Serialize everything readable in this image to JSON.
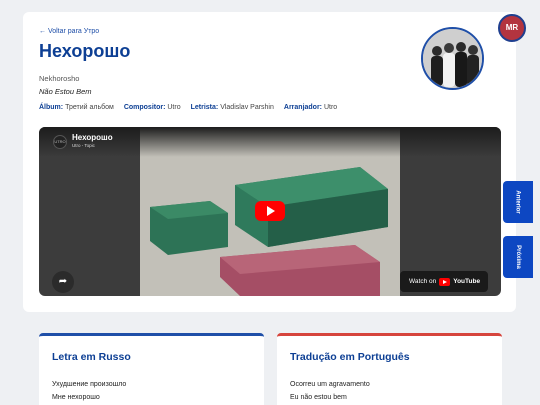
{
  "song": {
    "back_link": "← Voltar para Утро",
    "title": "Нехорошо",
    "transliteration": "Nekhorosho",
    "portuguese_title": "Não Estou Bem",
    "meta": [
      {
        "label": "Álbum:",
        "value": "Третий альбом"
      },
      {
        "label": "Compositor:",
        "value": "Utro"
      },
      {
        "label": "Letrista:",
        "value": "Vladislav Parshin"
      },
      {
        "label": "Arranjador:",
        "value": "Utro"
      }
    ]
  },
  "player": {
    "video_title": "Нехорошо",
    "channel": "Utro - Topic",
    "channel_logo_text": "UTRO",
    "watch_on": "Watch on",
    "youtube_word": "YouTube"
  },
  "nav": {
    "previous": "Anterior",
    "next": "Próxima",
    "fab_label": "MR"
  },
  "lyrics": {
    "russian": {
      "heading": "Letra em Russo",
      "lines": [
        "Ухудшение произошло",
        "Мне нехорошо"
      ]
    },
    "portuguese": {
      "heading": "Tradução em Português",
      "lines": [
        "Ocorreu um agravamento",
        "Eu não estou bem"
      ]
    }
  },
  "colors": {
    "accent_blue": "#0d3f94",
    "button_blue": "#0d47c2",
    "accent_red": "#d6453d",
    "youtube_red": "#ff0000"
  }
}
